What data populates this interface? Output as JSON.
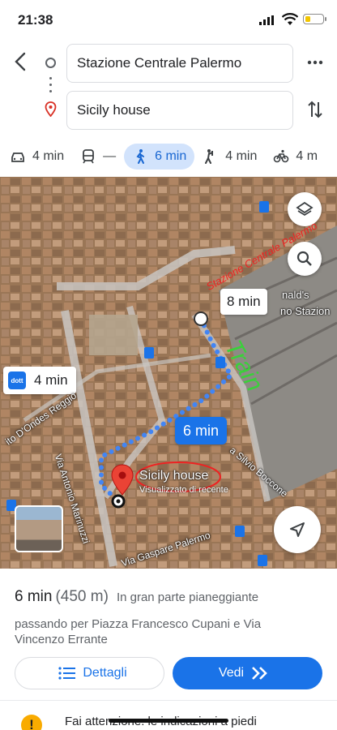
{
  "status_bar": {
    "time": "21:38"
  },
  "search": {
    "origin": "Stazione Centrale Palermo",
    "destination": "Sicily house"
  },
  "modes": [
    {
      "icon": "car-icon",
      "label": "4 min"
    },
    {
      "icon": "transit-icon",
      "label": "—"
    },
    {
      "icon": "walk-icon",
      "label": "6 min",
      "active": true
    },
    {
      "icon": "ride-icon",
      "label": "4 min"
    },
    {
      "icon": "bike-icon",
      "label": "4 m"
    }
  ],
  "map": {
    "scooter_chip": "4 min",
    "train_chip": "8 min",
    "walk_chip": "6 min",
    "destination_label": "Sicily house",
    "destination_sub": "Visualizzato di recente",
    "poi_label": "nald's",
    "station_label": "no Stazion",
    "streets": {
      "s1": "Via Antonio Marinuzzi",
      "s2": "Via Gaspare Palermo",
      "s3": "a Silvio Boccone",
      "s4": "ito D'Ondes Reggio"
    },
    "annotations": {
      "station": "Stazione Centrale Palermo",
      "train": "Train"
    }
  },
  "sheet": {
    "duration": "6 min",
    "distance": "(450 m)",
    "mostly": "In gran parte pianeggiante",
    "via": "passando per Piazza Francesco Cupani e Via Vincenzo Errante",
    "details_label": "Dettagli",
    "go_label": "Vedi",
    "warning": "Fai attenzione: le indicazioni a piedi"
  },
  "colors": {
    "accent": "#1a73e8",
    "active_mode_bg": "#d2e3fc",
    "route": "#4285f4",
    "warning": "#f9ab00"
  }
}
